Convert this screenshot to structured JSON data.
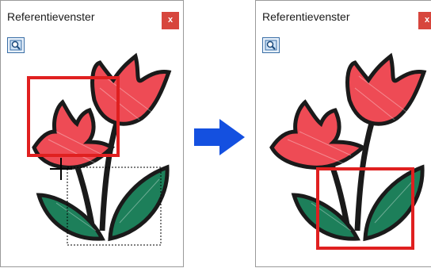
{
  "left_panel": {
    "title": "Referentievenster",
    "close_label": "x",
    "tool_icon": "zoom-to-fit-icon"
  },
  "right_panel": {
    "title": "Referentievenster",
    "close_label": "x",
    "tool_icon": "zoom-to-fit-icon"
  },
  "arrow": {
    "icon": "right-arrow-icon",
    "color": "#1450e0"
  },
  "colors": {
    "frame_red": "#e02020",
    "petal_red": "#ee4b55",
    "leaf_green": "#1d7f5a",
    "close_bg": "#d7463d"
  }
}
